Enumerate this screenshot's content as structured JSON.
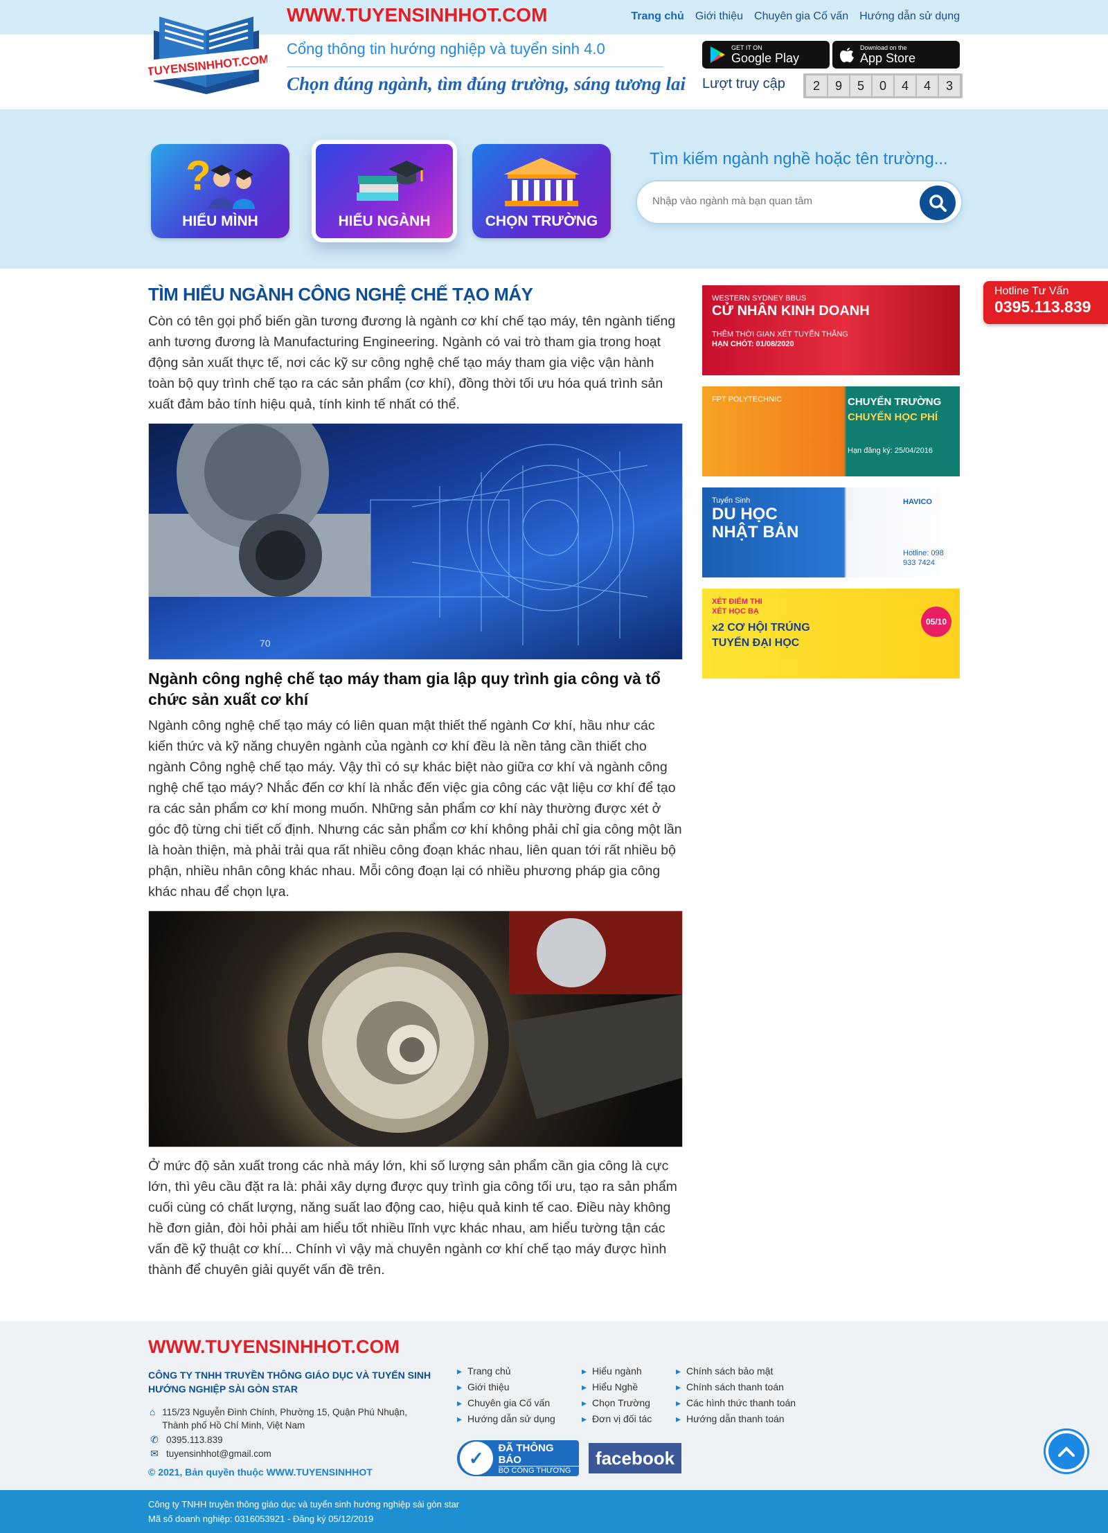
{
  "header": {
    "site_url": "WWW.TUYENSINHHOT.COM",
    "logo_text": "TUYENSINHHOT.COM",
    "nav": [
      "Trang chủ",
      "Giới thiệu",
      "Chuyên gia Cố vấn",
      "Hướng dẫn sử dụng"
    ],
    "tagline": "Cổng thông tin hướng nghiệp và tuyển sinh 4.0",
    "slogan": "Chọn đúng ngành, tìm đúng trường, sáng tương lai",
    "google_play": {
      "small": "GET IT ON",
      "big": "Google Play"
    },
    "app_store": {
      "small": "Download on the",
      "big": "App Store"
    },
    "visits_label": "Lượt truy cập",
    "visit_digits": [
      "2",
      "9",
      "5",
      "0",
      "4",
      "4",
      "3"
    ]
  },
  "hero": {
    "tiles": [
      "HIỂU MÌNH",
      "HIỂU NGÀNH",
      "CHỌN TRƯỜNG"
    ],
    "search_title": "Tìm kiếm ngành nghề hoặc tên trường...",
    "search_placeholder": "Nhập vào ngành mà bạn quan tâm"
  },
  "article": {
    "title": "TÌM HIỂU NGÀNH CÔNG NGHỆ CHẾ TẠO MÁY",
    "p1": "Còn có tên gọi phổ biến gần tương đương là ngành cơ khí chế tạo máy, tên ngành tiếng anh tương đương là Manufacturing Engineering. Ngành có vai trò tham gia trong hoạt động sản xuất thực tế, nơi các kỹ sư công nghệ chế tạo máy tham gia việc vận hành toàn bộ quy trình chế tạo ra các sản phẩm (cơ khí), đồng thời tối ưu hóa quá trình sản xuất đảm bảo tính hiệu quả, tính kinh tế nhất có thể.",
    "img1_label": "70",
    "h2": "Ngành công nghệ chế tạo máy tham gia lập quy trình gia công và tổ chức sản xuất cơ khí",
    "p2": "Ngành công nghệ chế tạo máy có liên quan mật thiết thế ngành Cơ khí, hầu như các kiến thức và kỹ năng chuyên ngành của ngành cơ khí đều là nền tảng cần thiết cho ngành Công nghệ chế tạo máy. Vậy thì có sự khác biệt nào giữa cơ khí và ngành công nghệ chế tạo máy? Nhắc đến cơ khí là nhắc đến việc gia công các vật liệu cơ khí để tạo ra các sản phẩm cơ khí mong muốn. Những sản phẩm cơ khí này thường được xét ở góc độ từng chi tiết cố định. Nhưng các sản phẩm cơ khí không phải chỉ gia công một lần là hoàn thiện, mà phải trải qua rất nhiều công đoạn khác nhau, liên quan tới rất nhiều bộ phận, nhiều nhân công khác nhau. Mỗi công đoạn lại có nhiều phương pháp gia công khác nhau để chọn lựa.",
    "p3": "Ở mức độ sản xuất trong các nhà máy lớn, khi số lượng sản phẩm cần gia công là cực lớn, thì yêu cầu đặt ra là: phải xây dựng được quy trình gia công tối ưu, tạo ra sản phẩm cuối cùng có chất lượng, năng suất lao động cao, hiệu quả kinh tế cao. Điều này không hề đơn giản, đòi hỏi phải am hiểu tốt nhiều lĩnh vực khác nhau, am hiểu tường tận các vấn đề kỹ thuật cơ khí... Chính vì vậy mà chuyên ngành cơ khí chế tạo máy được hình thành để chuyên giải quyết vấn đề trên."
  },
  "banners": [
    {
      "title": "CỬ NHÂN KINH DOANH",
      "sub": "WESTERN SYDNEY BBUS",
      "line1": "THÊM THỜI GIAN XÉT TUYỂN THẲNG",
      "line2": "HẠN CHÓT: 01/08/2020"
    },
    {
      "title": "CHUYỂN TRƯỜNG",
      "sub": "CHUYỂN HỌC PHÍ",
      "line1": "FPT POLYTECHNIC",
      "line2": "Hạn đăng ký: 25/04/2016"
    },
    {
      "title": "DU HỌC NHẬT BẢN",
      "sub": "Tuyển Sinh",
      "line1": "HAVICO",
      "line2": "Hotline: 098 933 7424"
    },
    {
      "title": "x2 CƠ HỘI TRÚNG TUYỂN ĐẠI HỌC",
      "sub": "XÉT ĐIỂM THI",
      "line1": "XÉT HỌC BẠ",
      "line2": "05/10"
    }
  ],
  "hotline": {
    "label": "Hotline Tư Vấn",
    "number": "0395.113.839"
  },
  "footer": {
    "url": "WWW.TUYENSINHHOT.COM",
    "company": "CÔNG TY TNHH TRUYỀN THÔNG GIÁO DỤC VÀ TUYỂN SINH HƯỚNG NGHIỆP SÀI GÒN STAR",
    "address": "115/23 Nguyễn Đình Chính, Phường 15, Quận Phú Nhuận, Thành phố Hồ Chí Minh, Việt Nam",
    "phone": "0395.113.839",
    "email": "tuyensinhhot@gmail.com",
    "copyright": "© 2021, Bản quyền thuộc WWW.TUYENSINHHOT",
    "col1": [
      "Trang chủ",
      "Giới thiệu",
      "Chuyên gia Cố vấn",
      "Hướng dẫn sử dụng"
    ],
    "col2": [
      "Hiểu ngành",
      "Hiểu Nghề",
      "Chọn Trường",
      "Đơn vị đối tác"
    ],
    "col3": [
      "Chính sách bảo mật",
      "Chính sách thanh toán",
      "Các hình thức thanh toán",
      "Hướng dẫn thanh toán"
    ],
    "gov_badge": {
      "line1": "ĐÃ THÔNG BÁO",
      "line2": "BỘ CÔNG THƯƠNG"
    },
    "facebook": "facebook",
    "bottom_line1": "Công ty TNHH truyền thông giáo dục và tuyển sinh hướng nghiệp sài gòn star",
    "bottom_line2": "Mã số doanh nghiệp: 0316053921 - Đăng ký 05/12/2019"
  },
  "colors": {
    "brand_red": "#e31e24",
    "brand_blue": "#0d4f92",
    "light_blue": "#d2eaf6"
  }
}
